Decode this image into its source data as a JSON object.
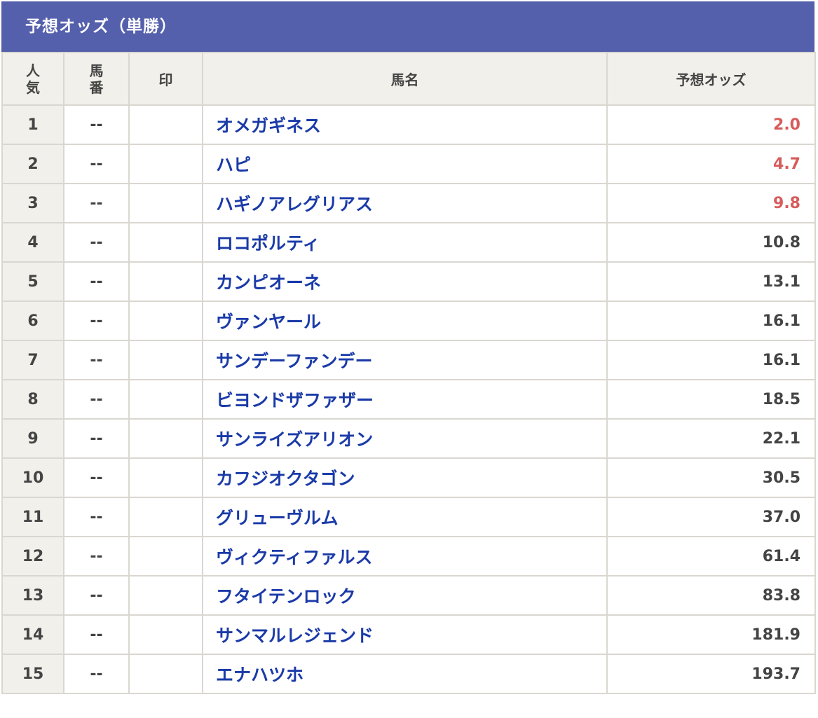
{
  "title": "予想オッズ（単勝）",
  "headers": {
    "rank_line1": "人",
    "rank_line2": "気",
    "num_line1": "馬",
    "num_line2": "番",
    "mark": "印",
    "name": "馬名",
    "odds": "予想オッズ"
  },
  "colors": {
    "header_bar": "#5560ad",
    "horse_name": "#1a3aa8",
    "favorite_odds": "#d75c5c",
    "normal_odds": "#444444"
  },
  "rows": [
    {
      "rank": "1",
      "num": "--",
      "mark": "",
      "name": "オメガギネス",
      "odds": "2.0",
      "hot": true
    },
    {
      "rank": "2",
      "num": "--",
      "mark": "",
      "name": "ハピ",
      "odds": "4.7",
      "hot": true
    },
    {
      "rank": "3",
      "num": "--",
      "mark": "",
      "name": "ハギノアレグリアス",
      "odds": "9.8",
      "hot": true
    },
    {
      "rank": "4",
      "num": "--",
      "mark": "",
      "name": "ロコポルティ",
      "odds": "10.8",
      "hot": false
    },
    {
      "rank": "5",
      "num": "--",
      "mark": "",
      "name": "カンピオーネ",
      "odds": "13.1",
      "hot": false
    },
    {
      "rank": "6",
      "num": "--",
      "mark": "",
      "name": "ヴァンヤール",
      "odds": "16.1",
      "hot": false
    },
    {
      "rank": "7",
      "num": "--",
      "mark": "",
      "name": "サンデーファンデー",
      "odds": "16.1",
      "hot": false
    },
    {
      "rank": "8",
      "num": "--",
      "mark": "",
      "name": "ビヨンドザファザー",
      "odds": "18.5",
      "hot": false
    },
    {
      "rank": "9",
      "num": "--",
      "mark": "",
      "name": "サンライズアリオン",
      "odds": "22.1",
      "hot": false
    },
    {
      "rank": "10",
      "num": "--",
      "mark": "",
      "name": "カフジオクタゴン",
      "odds": "30.5",
      "hot": false
    },
    {
      "rank": "11",
      "num": "--",
      "mark": "",
      "name": "グリューヴルム",
      "odds": "37.0",
      "hot": false
    },
    {
      "rank": "12",
      "num": "--",
      "mark": "",
      "name": "ヴィクティファルス",
      "odds": "61.4",
      "hot": false
    },
    {
      "rank": "13",
      "num": "--",
      "mark": "",
      "name": "フタイテンロック",
      "odds": "83.8",
      "hot": false
    },
    {
      "rank": "14",
      "num": "--",
      "mark": "",
      "name": "サンマルレジェンド",
      "odds": "181.9",
      "hot": false
    },
    {
      "rank": "15",
      "num": "--",
      "mark": "",
      "name": "エナハツホ",
      "odds": "193.7",
      "hot": false
    }
  ]
}
